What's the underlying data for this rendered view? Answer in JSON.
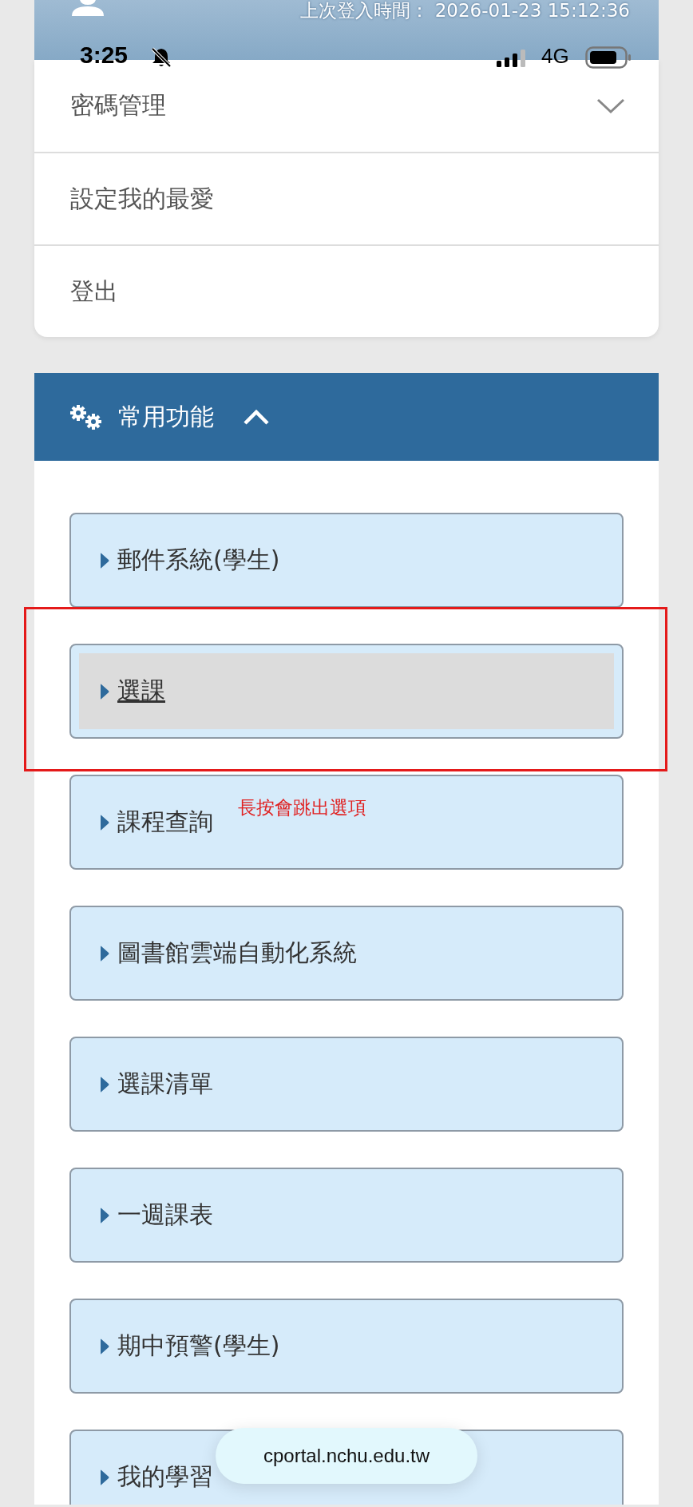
{
  "header": {
    "login_label": "上次登入時間：",
    "login_time": "2026-01-23 15:12:36"
  },
  "status_bar": {
    "time": "3:25",
    "network": "4G"
  },
  "account_menu": [
    {
      "label": "密碼管理",
      "kind": "dropdown",
      "expanded": false
    },
    {
      "label": "設定我的最愛",
      "kind": "link"
    },
    {
      "label": "登出",
      "kind": "link"
    }
  ],
  "section": {
    "title": "常用功能",
    "expanded": true,
    "items": [
      {
        "label": "郵件系統(學生)",
        "selected": false
      },
      {
        "label": "選課",
        "selected": true
      },
      {
        "label": "課程查詢",
        "selected": false
      },
      {
        "label": "圖書館雲端自動化系統",
        "selected": false
      },
      {
        "label": "選課清單",
        "selected": false
      },
      {
        "label": "一週課表",
        "selected": false
      },
      {
        "label": "期中預警(學生)",
        "selected": false
      },
      {
        "label": "我的學習",
        "selected": false
      }
    ]
  },
  "annotation": {
    "text": "長按會跳出選項"
  },
  "toast": {
    "text": "cportal.nchu.edu.tw"
  }
}
